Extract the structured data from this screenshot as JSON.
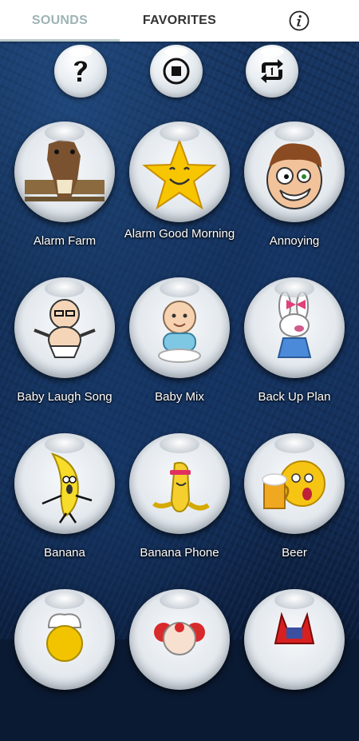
{
  "tabs": {
    "sounds": "SOUNDS",
    "favorites": "FAVORITES"
  },
  "icons": {
    "info": "info-icon",
    "help": "question-icon",
    "stop": "stop-icon",
    "repeat": "repeat-icon"
  },
  "colors": {
    "active_tab": "#9db3b5",
    "background": "#132d55"
  },
  "sounds": [
    {
      "label": "Alarm Farm",
      "icon": "horse-icon"
    },
    {
      "label": "Alarm Good Morning",
      "icon": "smiling-star-icon"
    },
    {
      "label": "Annoying",
      "icon": "cartoon-face-icon"
    },
    {
      "label": "Baby Laugh Song",
      "icon": "cartoon-baby-icon"
    },
    {
      "label": "Baby Mix",
      "icon": "sitting-baby-icon"
    },
    {
      "label": "Back Up Plan",
      "icon": "bunny-icon"
    },
    {
      "label": "Banana",
      "icon": "dancing-banana-icon"
    },
    {
      "label": "Banana Phone",
      "icon": "banana-phone-icon"
    },
    {
      "label": "Beer",
      "icon": "beer-smiley-icon"
    },
    {
      "label": "",
      "icon": "chef-icon"
    },
    {
      "label": "",
      "icon": "clown-icon"
    },
    {
      "label": "",
      "icon": "red-creature-icon"
    }
  ]
}
